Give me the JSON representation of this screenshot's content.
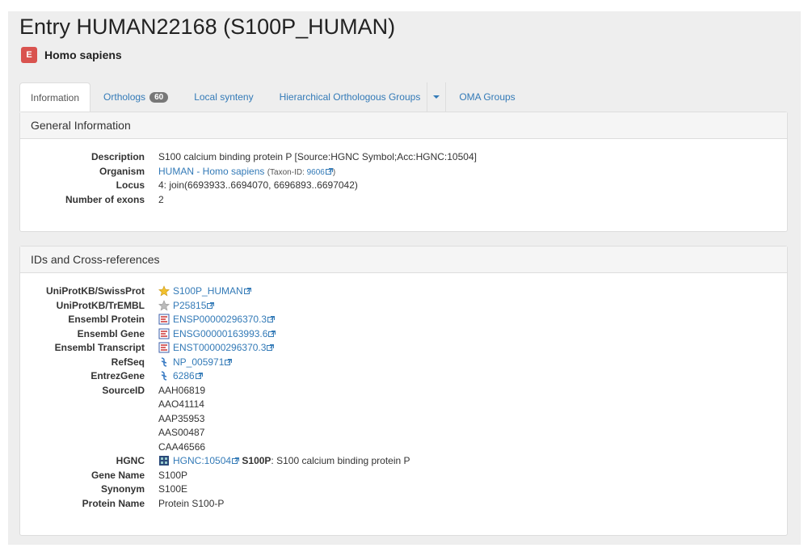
{
  "entry": {
    "title": "Entry HUMAN22168 (S100P_HUMAN)",
    "species_badge": "E",
    "species": "Homo sapiens"
  },
  "tabs": [
    {
      "label": "Information",
      "active": true
    },
    {
      "label": "Orthologs",
      "count": "60"
    },
    {
      "label": "Local synteny"
    },
    {
      "label": "Hierarchical Orthologous Groups"
    },
    {
      "label": "OMA Groups"
    }
  ],
  "general": {
    "heading": "General Information",
    "rows": {
      "description": {
        "label": "Description",
        "value": "S100 calcium binding protein P [Source:HGNC Symbol;Acc:HGNC:10504]"
      },
      "organism": {
        "label": "Organism",
        "link": "HUMAN - Homo sapiens",
        "taxon_prefix": "(Taxon-ID: ",
        "taxon_id": "9606",
        "taxon_suffix": ")"
      },
      "locus": {
        "label": "Locus",
        "value": "4: join(6693933..6694070, 6696893..6697042)"
      },
      "exons": {
        "label": "Number of exons",
        "value": "2"
      }
    }
  },
  "xrefs": {
    "heading": "IDs and Cross-references",
    "uniprot_swiss": {
      "label": "UniProtKB/SwissProt",
      "value": "S100P_HUMAN",
      "icon": "gold-star-icon"
    },
    "uniprot_trembl": {
      "label": "UniProtKB/TrEMBL",
      "value": "P25815",
      "icon": "grey-star-icon"
    },
    "ensembl_protein": {
      "label": "Ensembl Protein",
      "value": "ENSP00000296370.3",
      "icon": "ensembl-icon"
    },
    "ensembl_gene": {
      "label": "Ensembl Gene",
      "value": "ENSG00000163993.6",
      "icon": "ensembl-icon"
    },
    "ensembl_transcript": {
      "label": "Ensembl Transcript",
      "value": "ENST00000296370.3",
      "icon": "ensembl-icon"
    },
    "refseq": {
      "label": "RefSeq",
      "value": "NP_005971",
      "icon": "ncbi-icon"
    },
    "entrez": {
      "label": "EntrezGene",
      "value": "6286",
      "icon": "ncbi-icon"
    },
    "source_id": {
      "label": "SourceID",
      "values": [
        "AAH06819",
        "AAO41114",
        "AAP35953",
        "AAS00487",
        "CAA46566"
      ]
    },
    "hgnc": {
      "label": "HGNC",
      "value": "HGNC:10504",
      "symbol": "S100P",
      "desc": ": S100 calcium binding protein P",
      "icon": "hgnc-icon"
    },
    "gene_name": {
      "label": "Gene Name",
      "value": "S100P"
    },
    "synonym": {
      "label": "Synonym",
      "value": "S100E"
    },
    "protein_name": {
      "label": "Protein Name",
      "value": "Protein S100-P"
    }
  },
  "colors": {
    "link": "#337ab7",
    "badge_red": "#d9534f",
    "badge_grey": "#777777"
  }
}
